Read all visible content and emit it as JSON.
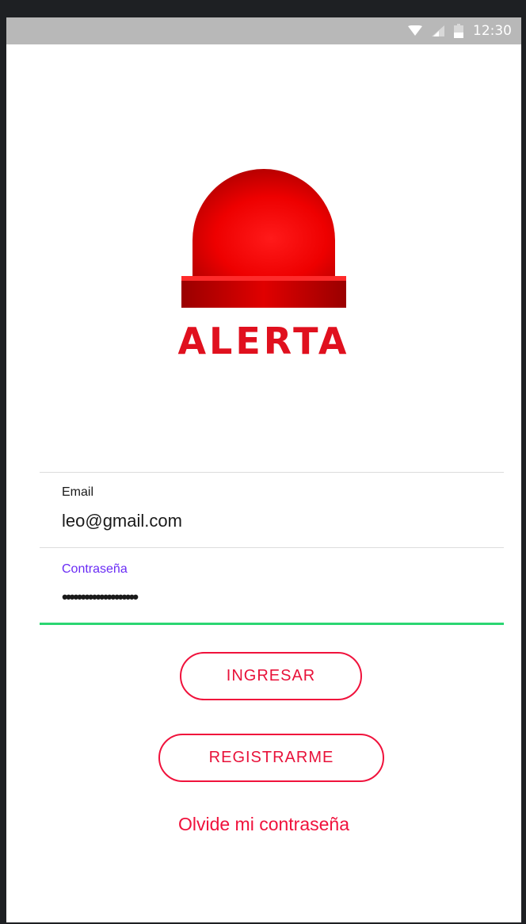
{
  "status_bar": {
    "time": "12:30",
    "wifi_icon": "wifi-icon",
    "signal_icon": "signal-icon",
    "battery_icon": "battery-icon"
  },
  "logo": {
    "text": "ALERTA",
    "icon": "siren-icon",
    "color": "#e0101e"
  },
  "form": {
    "email": {
      "label": "Email",
      "value": "leo@gmail.com"
    },
    "password": {
      "label": "Contraseña",
      "value": "••••••••••••••••••••",
      "label_color": "#6a2cf5",
      "underline_color": "#2bd672"
    }
  },
  "buttons": {
    "login_label": "INGRESAR",
    "register_label": "REGISTRARME",
    "forgot_label": "Olvide mi contraseña",
    "accent_color": "#f0123c"
  }
}
